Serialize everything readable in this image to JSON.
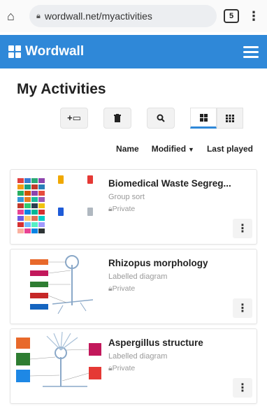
{
  "browser": {
    "home_icon": "home-icon",
    "url": "wordwall.net/myactivities",
    "tab_count": "5",
    "menu_icon": "vertical-dots-icon"
  },
  "app": {
    "logo_text": "Wordwall",
    "brand_color": "#2f88d8"
  },
  "page": {
    "title": "My Activities"
  },
  "toolbar": {
    "new_folder_label": "+▭",
    "delete_icon": "trash-icon",
    "search_icon": "search-icon",
    "grid_large_icon": "grid-large-icon",
    "grid_small_icon": "grid-small-icon"
  },
  "sort": {
    "name_label": "Name",
    "modified_label": "Modified",
    "last_played_label": "Last played"
  },
  "activities": [
    {
      "title": "Biomedical Waste Segreg...",
      "type": "Group sort",
      "privacy": "Private"
    },
    {
      "title": "Rhizopus morphology",
      "type": "Labelled diagram",
      "privacy": "Private"
    },
    {
      "title": "Aspergillus structure",
      "type": "Labelled diagram",
      "privacy": "Private"
    }
  ]
}
